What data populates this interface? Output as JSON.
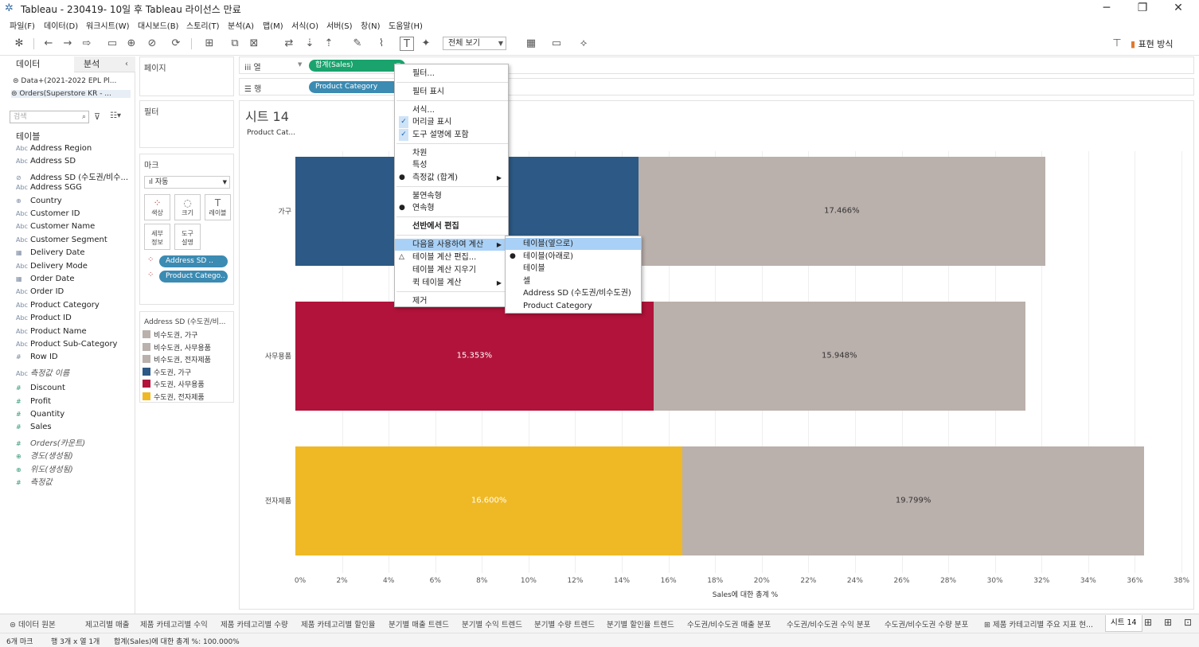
{
  "window": {
    "title": "Tableau - 230419- 10일 후 Tableau 라이선스 만료"
  },
  "menu": [
    "파일(F)",
    "데이터(D)",
    "워크시트(W)",
    "대시보드(B)",
    "스토리(T)",
    "분석(A)",
    "맵(M)",
    "서식(O)",
    "서버(S)",
    "창(N)",
    "도움말(H)"
  ],
  "toolbar": {
    "fit": "전체 보기",
    "show_me": "표현 방식"
  },
  "data_pane": {
    "tab_data": "데이터",
    "tab_analysis": "분석",
    "datasources": [
      "Data+(2021-2022 EPL Pl...",
      "Orders(Superstore KR - ..."
    ],
    "search_placeholder": "검색",
    "tables_header": "테이블",
    "dimensions": [
      {
        "icon": "Abc",
        "name": "Address Region"
      },
      {
        "icon": "Abc",
        "name": "Address SD"
      },
      {
        "icon": "⊘",
        "name": "Address SD (수도권/비수..."
      },
      {
        "icon": "Abc",
        "name": "Address SGG"
      },
      {
        "icon": "⊕",
        "name": "Country"
      },
      {
        "icon": "Abc",
        "name": "Customer ID"
      },
      {
        "icon": "Abc",
        "name": "Customer Name"
      },
      {
        "icon": "Abc",
        "name": "Customer Segment"
      },
      {
        "icon": "▦",
        "name": "Delivery Date"
      },
      {
        "icon": "Abc",
        "name": "Delivery Mode"
      },
      {
        "icon": "▦",
        "name": "Order Date"
      },
      {
        "icon": "Abc",
        "name": "Order ID"
      },
      {
        "icon": "Abc",
        "name": "Product Category"
      },
      {
        "icon": "Abc",
        "name": "Product ID"
      },
      {
        "icon": "Abc",
        "name": "Product Name"
      },
      {
        "icon": "Abc",
        "name": "Product Sub-Category"
      },
      {
        "icon": "#",
        "name": "Row ID"
      },
      {
        "icon": "Abc",
        "name": "측정값 이름"
      }
    ],
    "measures": [
      {
        "icon": "#",
        "name": "Discount"
      },
      {
        "icon": "#",
        "name": "Profit"
      },
      {
        "icon": "#",
        "name": "Quantity"
      },
      {
        "icon": "#",
        "name": "Sales"
      },
      {
        "icon": "#",
        "name": "Orders(카운트)"
      },
      {
        "icon": "⊕",
        "name": "경도(생성됨)"
      },
      {
        "icon": "⊕",
        "name": "위도(생성됨)"
      },
      {
        "icon": "#",
        "name": "측정값"
      }
    ]
  },
  "cards": {
    "pages": "페이지",
    "filters": "필터",
    "marks": "마크",
    "mark_type": "자동",
    "mark_buttons": [
      "색상",
      "크기",
      "레이블",
      "세부\n정보",
      "도구\n설명"
    ],
    "mark_pills": [
      "Address SD ..",
      "Product Catego.."
    ],
    "legend_title": "Address SD (수도권/비...",
    "legend": [
      {
        "label": "비수도권, 가구",
        "color": "#bab0ac"
      },
      {
        "label": "비수도권, 사무용품",
        "color": "#bab0ac"
      },
      {
        "label": "비수도권, 전자제품",
        "color": "#bab0ac"
      },
      {
        "label": "수도권, 가구",
        "color": "#2c5985"
      },
      {
        "label": "수도권, 사무용품",
        "color": "#b1133a"
      },
      {
        "label": "수도권, 전자제품",
        "color": "#efb926"
      }
    ]
  },
  "shelves": {
    "columns_label": "열",
    "rows_label": "행",
    "columns_pill": "합계(Sales)",
    "rows_pill": "Product Category"
  },
  "sheet": {
    "title": "시트 14",
    "row_header": "Product Cat...",
    "x_axis_title": "Sales에 대한 총계 %"
  },
  "chart_data": {
    "type": "bar",
    "stacked": true,
    "orientation": "horizontal",
    "categories": [
      "가구",
      "사무용품",
      "전자제품"
    ],
    "series": [
      {
        "name": "수도권",
        "colors": [
          "#2c5985",
          "#b1133a",
          "#efb926"
        ],
        "values": [
          14.7,
          15.353,
          16.6
        ],
        "labels": [
          "",
          "15.353%",
          "16.600%"
        ]
      },
      {
        "name": "비수도권",
        "color": "#bab0ac",
        "values": [
          17.466,
          15.948,
          19.799
        ],
        "labels": [
          "17.466%",
          "15.948%",
          "19.799%"
        ]
      }
    ],
    "xlim": [
      0,
      38
    ],
    "xticks": [
      "0%",
      "2%",
      "4%",
      "6%",
      "8%",
      "10%",
      "12%",
      "14%",
      "16%",
      "18%",
      "20%",
      "22%",
      "24%",
      "26%",
      "28%",
      "30%",
      "32%",
      "34%",
      "36%",
      "38%"
    ],
    "xlabel": "Sales에 대한 총계 %"
  },
  "context_menu": {
    "items": [
      {
        "label": "필터...",
        "mark": ""
      },
      {
        "label": "필터 표시",
        "mark": ""
      },
      {
        "label": "서식...",
        "mark": ""
      },
      {
        "label": "머리글 표시",
        "mark": "check"
      },
      {
        "label": "도구 설명에 포함",
        "mark": "check"
      },
      {
        "label": "차원",
        "mark": ""
      },
      {
        "label": "특성",
        "mark": ""
      },
      {
        "label": "측정값 (합계)",
        "mark": "dot",
        "sub": true
      },
      {
        "label": "불연속형",
        "mark": ""
      },
      {
        "label": "연속형",
        "mark": "dot"
      },
      {
        "label": "선반에서 편집",
        "mark": "",
        "bold": true
      },
      {
        "label": "다음을 사용하여 계산",
        "mark": "",
        "sub": true,
        "highlight": true
      },
      {
        "label": "테이블 계산 편집...",
        "mark": "delta"
      },
      {
        "label": "테이블 계산 지우기",
        "mark": ""
      },
      {
        "label": "퀵 테이블 계산",
        "mark": "",
        "sub": true
      },
      {
        "label": "제거",
        "mark": ""
      }
    ],
    "submenu": [
      {
        "label": "테이블(옆으로)",
        "highlight": true
      },
      {
        "label": "테이블(아래로)",
        "mark": "dot"
      },
      {
        "label": "테이블"
      },
      {
        "label": "셀"
      },
      {
        "label": "Address SD (수도권/비수도권)"
      },
      {
        "label": "Product Category"
      }
    ]
  },
  "sheet_tabs": [
    "데이터 원본",
    "제고리별 매출",
    "제품 카테고리별 수익",
    "제품 카테고리별 수량",
    "제품 카테고리별 할인율",
    "분기별 매출 트렌드",
    "분기별 수익 트렌드",
    "분기별 수량 트렌드",
    "분기별 할인율 트렌드",
    "수도권/비수도권 매출 분포",
    "수도권/비수도권 수익 분포",
    "수도권/비수도권 수량 분포",
    "제품 카테고리별 주요 지표 현...",
    "시트 14"
  ],
  "status": {
    "marks": "6개 마크",
    "dims": "행 3개 x 열 1개",
    "sum": "합계(Sales)에 대한 총계 %: 100.000%"
  }
}
